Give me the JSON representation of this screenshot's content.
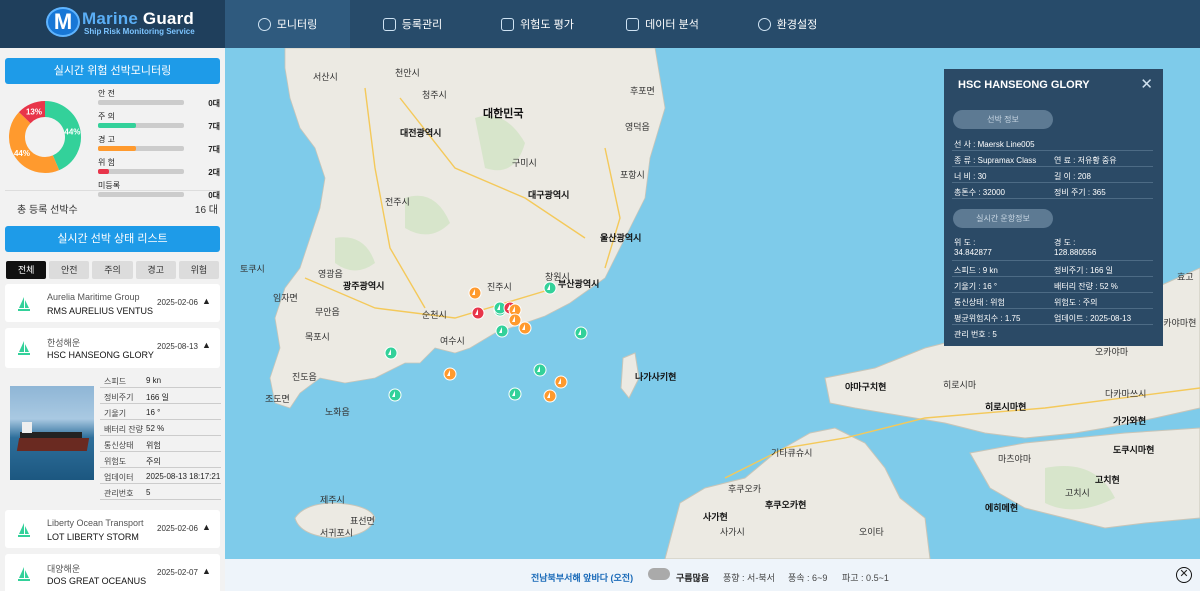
{
  "app": {
    "brand_a": "Marine",
    "brand_b": " Guard",
    "tagline": "Ship Risk Monitoring Service",
    "logo_letter": "M"
  },
  "nav": [
    {
      "label": "모니터링",
      "icon": "monitor-icon",
      "active": true
    },
    {
      "label": "등록관리",
      "icon": "ship-register-icon"
    },
    {
      "label": "위험도 평가",
      "icon": "clipboard-icon"
    },
    {
      "label": "데이터 분석",
      "icon": "chart-icon"
    },
    {
      "label": "환경설정",
      "icon": "gear-icon"
    }
  ],
  "sidebar": {
    "monitor_title": "실시간 위험 선박모니터링",
    "donut": {
      "segments": [
        {
          "name": "주의",
          "percent": 44,
          "label": "44%",
          "color": "#33d19a"
        },
        {
          "name": "경고",
          "percent": 44,
          "label": "44%",
          "color": "#ff9a2e"
        },
        {
          "name": "위험",
          "percent": 13,
          "label": "13%",
          "color": "#e8354a"
        }
      ]
    },
    "legend": [
      {
        "label": "안 전",
        "count": "0대",
        "fill": 0,
        "color": "#33d19a"
      },
      {
        "label": "주 의",
        "count": "7대",
        "fill": 0.44,
        "color": "#33d19a"
      },
      {
        "label": "경 고",
        "count": "7대",
        "fill": 0.44,
        "color": "#ff9a2e"
      },
      {
        "label": "위 험",
        "count": "2대",
        "fill": 0.13,
        "color": "#e8354a"
      },
      {
        "label": "미등록",
        "count": "0대",
        "fill": 0,
        "color": "#999999"
      }
    ],
    "total_label": "총 등록 선박수",
    "total_value": "16 대",
    "list_title": "실시간 선박 상태 리스트",
    "filters": [
      "전체",
      "안전",
      "주의",
      "경고",
      "위험"
    ],
    "active_filter": "전체",
    "cards": [
      {
        "company": "Aurelia Maritime Group",
        "name": "RMS AURELIUS VENTUS",
        "date": "2025-02-06",
        "arrow": "▲"
      },
      {
        "company": "한성해운",
        "name": "HSC HANSEONG GLORY",
        "date": "2025-08-13",
        "arrow": "▲"
      },
      {
        "company": "Liberty Ocean Transport",
        "name": "LOT LIBERTY STORM",
        "date": "2025-02-06",
        "arrow": "▲"
      },
      {
        "company": "대양해운",
        "name": "DOS GREAT OCEANUS",
        "date": "2025-02-07",
        "arrow": "▲"
      }
    ],
    "detail": [
      {
        "k": "스피드",
        "v": "9  kn"
      },
      {
        "k": "정비주기",
        "v": "166  일"
      },
      {
        "k": "기울기",
        "v": "16  °"
      },
      {
        "k": "배터리 잔량",
        "v": "52  %"
      },
      {
        "k": "통신상태",
        "v": "위험"
      },
      {
        "k": "위험도",
        "v": "주의"
      },
      {
        "k": "업데이터",
        "v": "2025-08-13 18:17:21"
      },
      {
        "k": "관리번호",
        "v": "5"
      }
    ]
  },
  "map": {
    "labels": [
      {
        "t": "천안시",
        "cls": ""
      },
      {
        "t": "서산시",
        "cls": ""
      },
      {
        "t": "청주시",
        "cls": ""
      },
      {
        "t": "대한민국",
        "cls": "big"
      },
      {
        "t": "대전광역시",
        "cls": "bold"
      },
      {
        "t": "구미시",
        "cls": ""
      },
      {
        "t": "포항시",
        "cls": ""
      },
      {
        "t": "대구광역시",
        "cls": "bold"
      },
      {
        "t": "전주시",
        "cls": ""
      },
      {
        "t": "울산광역시",
        "cls": "bold"
      },
      {
        "t": "영광읍",
        "cls": ""
      },
      {
        "t": "광주광역시",
        "cls": "bold"
      },
      {
        "t": "진주시",
        "cls": ""
      },
      {
        "t": "창원시",
        "cls": ""
      },
      {
        "t": "부산광역시",
        "cls": "bold"
      },
      {
        "t": "순천시",
        "cls": ""
      },
      {
        "t": "무안읍",
        "cls": ""
      },
      {
        "t": "목포시",
        "cls": ""
      },
      {
        "t": "여수시",
        "cls": ""
      },
      {
        "t": "진도읍",
        "cls": ""
      },
      {
        "t": "노화읍",
        "cls": ""
      },
      {
        "t": "조도면",
        "cls": ""
      },
      {
        "t": "나가사키현",
        "cls": "bold"
      },
      {
        "t": "기타큐슈시",
        "cls": ""
      },
      {
        "t": "후쿠오카",
        "cls": ""
      },
      {
        "t": "사가현",
        "cls": "bold"
      },
      {
        "t": "후쿠오카현",
        "cls": "bold"
      },
      {
        "t": "사가시",
        "cls": ""
      },
      {
        "t": "제주시",
        "cls": ""
      },
      {
        "t": "서귀포시",
        "cls": ""
      },
      {
        "t": "표선면",
        "cls": ""
      },
      {
        "t": "오이타",
        "cls": ""
      },
      {
        "t": "야마구치현",
        "cls": "bold"
      },
      {
        "t": "히로시마",
        "cls": ""
      },
      {
        "t": "히로시마현",
        "cls": "bold"
      },
      {
        "t": "오카야마",
        "cls": ""
      },
      {
        "t": "다카마쓰시",
        "cls": ""
      },
      {
        "t": "가가와현",
        "cls": "bold"
      },
      {
        "t": "도쿠시마현",
        "cls": "bold"
      },
      {
        "t": "마츠야마",
        "cls": ""
      },
      {
        "t": "에히메현",
        "cls": "bold"
      },
      {
        "t": "고치현",
        "cls": "bold"
      },
      {
        "t": "고치시",
        "cls": ""
      },
      {
        "t": "영덕읍",
        "cls": ""
      },
      {
        "t": "후포면",
        "cls": ""
      },
      {
        "t": "임자면",
        "cls": ""
      },
      {
        "t": "토쿠시",
        "cls": ""
      },
      {
        "t": "효고",
        "cls": ""
      },
      {
        "t": "오카야마현",
        "cls": ""
      }
    ],
    "markers": [
      {
        "risk": "warning",
        "color": "#ff9a2e"
      },
      {
        "risk": "caution",
        "color": "#33d19a"
      },
      {
        "risk": "danger",
        "color": "#e8354a"
      },
      {
        "risk": "caution",
        "color": "#33d19a"
      },
      {
        "risk": "danger",
        "color": "#e8354a"
      },
      {
        "risk": "warning",
        "color": "#ff9a2e"
      },
      {
        "risk": "warning",
        "color": "#ff9a2e"
      },
      {
        "risk": "caution",
        "color": "#33d19a"
      },
      {
        "risk": "warning",
        "color": "#ff9a2e"
      },
      {
        "risk": "caution",
        "color": "#33d19a"
      },
      {
        "risk": "caution",
        "color": "#33d19a"
      },
      {
        "risk": "caution",
        "color": "#33d19a"
      },
      {
        "risk": "warning",
        "color": "#ff9a2e"
      },
      {
        "risk": "caution",
        "color": "#33d19a"
      },
      {
        "risk": "warning",
        "color": "#ff9a2e"
      },
      {
        "risk": "warning",
        "color": "#ff9a2e"
      },
      {
        "risk": "caution",
        "color": "#33d19a"
      },
      {
        "risk": "caution",
        "color": "#33d19a"
      }
    ]
  },
  "info": {
    "title": "HSC HANSEONG GLORY",
    "sec1": "선박 정보",
    "rows1": [
      [
        "선 사 :  Maersk Line005",
        ""
      ],
      [
        "종 류 :  Supramax Class",
        "연 료 :  저유황 중유"
      ],
      [
        "너 비 :  30",
        "길 이 :  208"
      ],
      [
        "총톤수 :  32000",
        "정비 주기 :  365"
      ]
    ],
    "sec2": "실시간 운항정보",
    "lat_label": "위 도 :",
    "lat": "34.842877",
    "lon_label": "경 도 :",
    "lon": "128.880556",
    "rows2": [
      [
        "스피드 :  9 kn",
        "정비주기 :  166 일"
      ],
      [
        "기울기 :  16 °",
        "배터리 잔량 :  52 %"
      ],
      [
        "통신상태 :  위험",
        "위험도 :  주의"
      ],
      [
        "평균위험지수 :  1.75",
        "업데이트 :  2025-08-13"
      ],
      [
        "관리 번호 :  5",
        ""
      ]
    ]
  },
  "weather": {
    "location": "전남북부서해 앞바다 (오전)",
    "sky": "구름많음",
    "wind_dir": "풍향 : 서-북서",
    "wind_speed": "풍속 : 6~9",
    "wave": "파고 : 0.5~1"
  }
}
